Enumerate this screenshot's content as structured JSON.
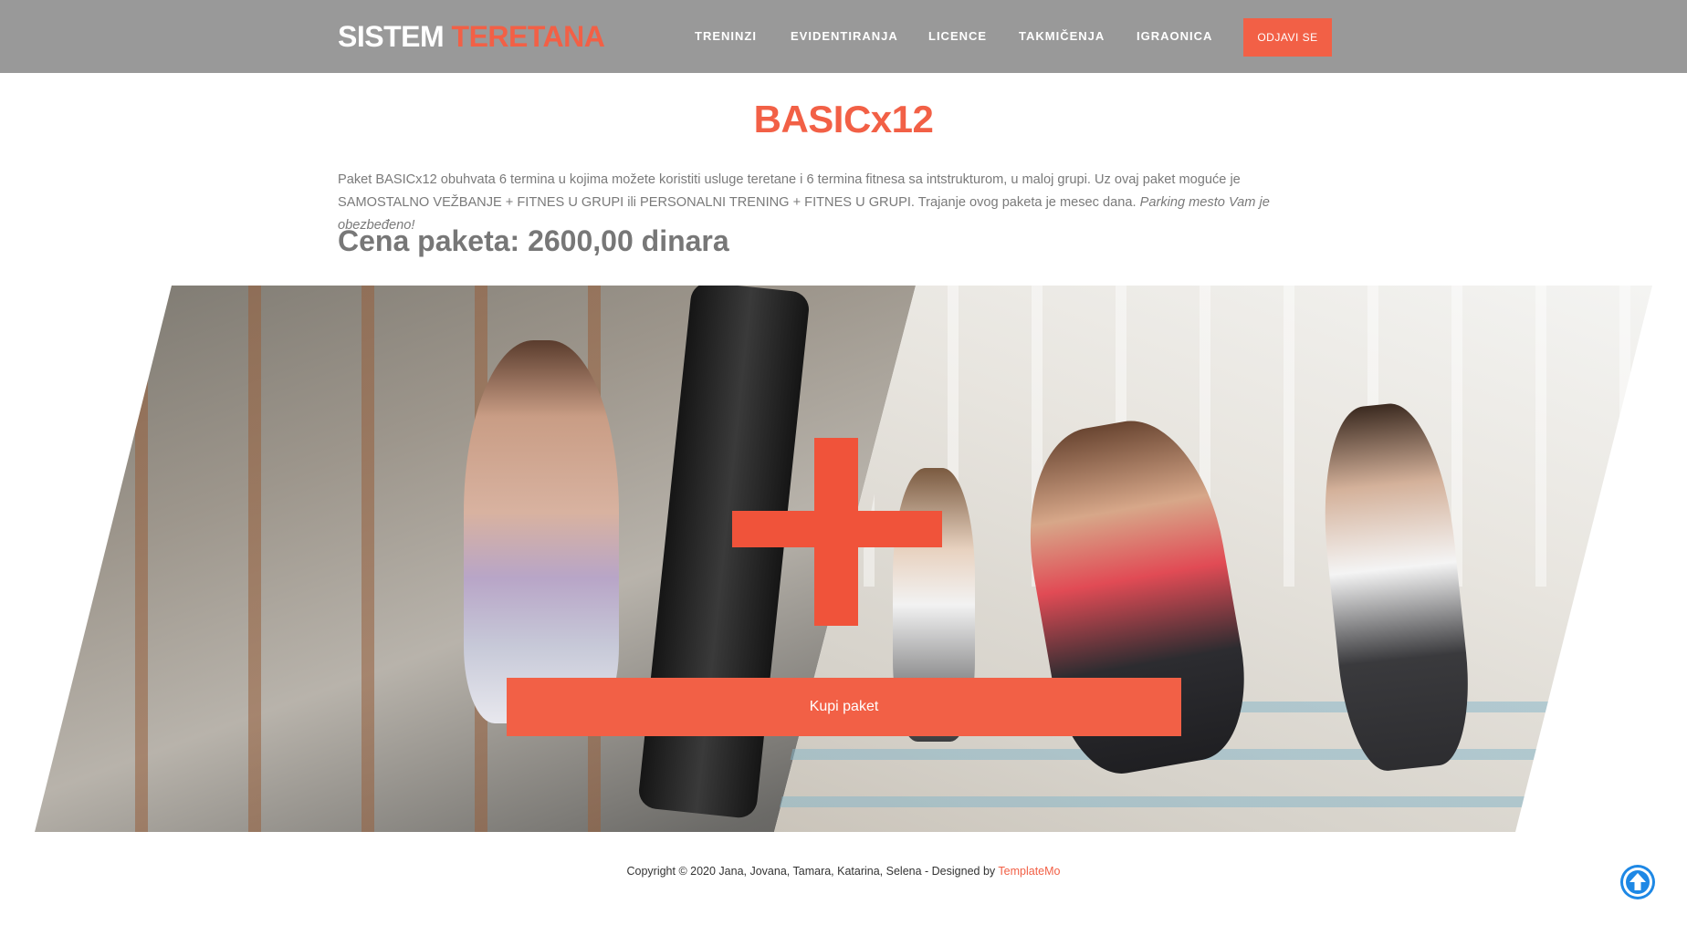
{
  "header": {
    "logo_part1": "SISTEM",
    "logo_part2": "TERETANA",
    "nav": [
      {
        "label": "TRENINZI"
      },
      {
        "label": "EVIDENTIRANJA"
      },
      {
        "label": "LICENCE"
      },
      {
        "label": "TAKMIČENJA"
      },
      {
        "label": "IGRAONICA"
      }
    ],
    "logout_label": "ODJAVI SE"
  },
  "main": {
    "title": "BASICx12",
    "description": "Paket BASICx12 obuhvata 6 termina u kojima možete koristiti usluge teretane i 6 termina fitnesa sa intstrukturom, u maloj grupi. Uz ovaj paket moguće je SAMOSTALNO VEŽBANJE + FITNES U GRUPI ili PERSONALNI TRENING + FITNES U GRUPI. Trajanje ovog paketa je mesec dana.",
    "description_italic": "Parking mesto Vam je obezbeđeno!",
    "price": "Cena paketa: 2600,00 dinara",
    "buy_label": "Kupi paket"
  },
  "footer": {
    "copyright": "Copyright © 2020 Jana, Jovana, Tamara, Katarina, Selena - Designed by",
    "brand": "TemplateMo"
  },
  "icons": {
    "plus": "plus-icon",
    "scroll_top": "arrow-up-circle-icon"
  },
  "colors": {
    "accent": "#f26046",
    "header_bg": "#999999",
    "scroll_top": "#1e88e5"
  }
}
